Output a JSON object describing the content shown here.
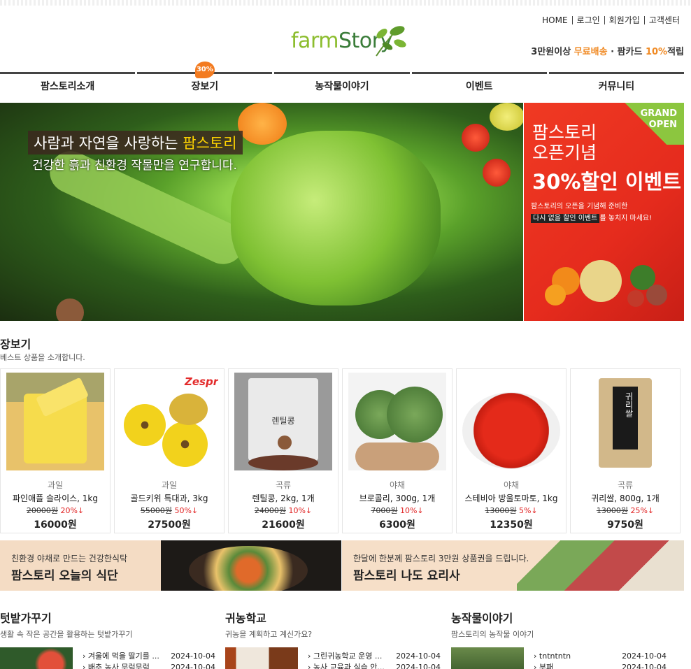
{
  "header": {
    "logo": {
      "part1": "farm",
      "part2": "Story"
    },
    "links": [
      "HOME",
      "로그인",
      "회원가입",
      "고객센터"
    ],
    "promo": {
      "a": "3만원이상 ",
      "b": "무료배송",
      "c": " · 팜카드 ",
      "d": "10%",
      "e": "적립"
    }
  },
  "nav": {
    "items": [
      "팜스토리소개",
      "장보기",
      "농작물이야기",
      "이벤트",
      "커뮤니티"
    ],
    "badge": "30%"
  },
  "hero": {
    "headline_a": "사람과 자연을 사랑하는 ",
    "headline_b": "팜스토리",
    "sub": "건강한 흙과 친환경 작물만을 연구합니다."
  },
  "event": {
    "corner": "GRAND\nOPEN",
    "line1": "팜스토리",
    "line2": "오픈기념",
    "big": "30%할인 이벤트",
    "desc1": "팜스토리의 오픈을 기념해 준비한",
    "desc2a": "다시 없을 할인 이벤트",
    "desc2b": "를 놓치지 마세요!"
  },
  "shop": {
    "title": "장보기",
    "subtitle": "베스트 상품을 소개합니다.",
    "products": [
      {
        "cat": "과일",
        "name": "파인애플 슬라이스, 1kg",
        "orig": "20000원",
        "pct": "20%↓",
        "price": "16000원"
      },
      {
        "cat": "과일",
        "name": "골드키위 특대과, 3kg",
        "orig": "55000원",
        "pct": "50%↓",
        "price": "27500원"
      },
      {
        "cat": "곡류",
        "name": "렌틸콩, 2kg, 1개",
        "orig": "24000원",
        "pct": "10%↓",
        "price": "21600원"
      },
      {
        "cat": "야채",
        "name": "브로콜리, 300g, 1개",
        "orig": "7000원",
        "pct": "10%↓",
        "price": "6300원"
      },
      {
        "cat": "야채",
        "name": "스테비아 방울토마토, 1kg",
        "orig": "13000원",
        "pct": "5%↓",
        "price": "12350원"
      },
      {
        "cat": "곡류",
        "name": "귀리쌀, 800g, 1개",
        "orig": "13000원",
        "pct": "25%↓",
        "price": "9750원"
      }
    ],
    "img_texts": {
      "zespri": "Zespri",
      "lentil": "렌틸콩",
      "oat": "귀리쌀"
    }
  },
  "banners": [
    {
      "small": "친환경 야채로 만드는 건강한식탁",
      "big": "팜스토리 오늘의 식단"
    },
    {
      "small": "한달에 한분께 팜스토리 3만원 상품권을 드립니다.",
      "big": "팜스토리 나도 요리사"
    }
  ],
  "columns": [
    {
      "title": "텃밭가꾸기",
      "subtitle": "생활 속 작은 공간을 활용하는 텃밭가꾸기",
      "items": [
        {
          "t": "겨울에 먹을 딸기를 ...",
          "d": "2024-10-04"
        },
        {
          "t": "배추 농사 무럭무럭",
          "d": "2024-10-04"
        }
      ]
    },
    {
      "title": "귀농학교",
      "subtitle": "귀농을 계획하고 계신가요?",
      "items": [
        {
          "t": "그린귀농학교 운영 ...",
          "d": "2024-10-04"
        },
        {
          "t": "농사 교육과 실습 안...",
          "d": "2024-10-04"
        }
      ]
    },
    {
      "title": "농작물이야기",
      "subtitle": "팜스토리의 농작물 이야기",
      "items": [
        {
          "t": "tntntntn",
          "d": "2024-10-04"
        },
        {
          "t": "부패",
          "d": "2024-10-04"
        }
      ]
    }
  ],
  "colors": {
    "accent": "#f08a24",
    "green": "#8cbd2e",
    "event_red": "#e52b1d",
    "discount": "#e02020"
  }
}
